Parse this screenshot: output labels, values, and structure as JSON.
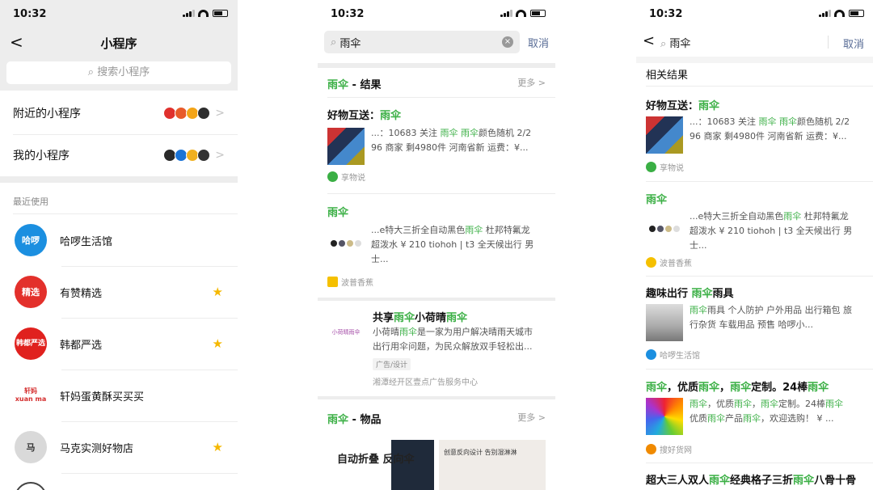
{
  "status": {
    "time": "10:32"
  },
  "p1": {
    "back": "<",
    "title": "小程序",
    "search_placeholder": "搜索小程序",
    "menu": [
      {
        "label": "附近的小程序",
        "icon_colors": [
          "#e0312d",
          "#e85b2a",
          "#2e2e2e",
          "#f3a417"
        ]
      },
      {
        "label": "我的小程序",
        "icon_colors": [
          "#2a2a2a",
          "#1a73d6",
          "#f0b020",
          "#333333"
        ]
      }
    ],
    "recent_label": "最近使用",
    "apps": [
      {
        "name": "哈啰生活馆",
        "avatar_text": "哈啰",
        "color": "#1b8fe0",
        "star": false
      },
      {
        "name": "有赞精选",
        "avatar_text": "精选",
        "color": "#e3302b",
        "star": true
      },
      {
        "name": "韩都严选",
        "avatar_text": "韩都严选",
        "color": "#e0211e",
        "star": true
      },
      {
        "name": "轩妈蛋黄酥买买买",
        "avatar_text": "轩妈 xuan ma",
        "color": "#d42d2d",
        "star": false
      },
      {
        "name": "马克实测好物店",
        "avatar_text": "马",
        "color": "#cfcfcf",
        "star": true
      }
    ],
    "star": "★",
    "chevron": ">"
  },
  "p2": {
    "query": "雨伞",
    "clear": "×",
    "cancel": "取消",
    "results_head": {
      "kw": "雨伞",
      "rest": " - 结果",
      "more": "更多 >"
    },
    "r1": {
      "title_a": "好物互送：",
      "title_kw": "雨伞",
      "desc_a": "...：10683 关注 ",
      "desc_kw1": "雨伞",
      "desc_sp": " ",
      "desc_kw2": "雨伞",
      "desc_b": "颜色随机 2/2",
      "desc_l2": "96 商家 剩4980件 河南省新 运费：¥...",
      "src": "享物说"
    },
    "r2": {
      "title": "雨伞",
      "desc_a": "...e特大三折全自动黑色",
      "desc_kw": "雨伞",
      "desc_b": " 杜邦特氟龙",
      "desc_l2": "超泼水 ¥ 210 tiohoh | t3 全天候出行 男",
      "desc_l3": "士...",
      "src": "波普香蕉"
    },
    "ad": {
      "logo_text": "小荷晴雨伞",
      "title_a": "共享",
      "title_kw1": "雨伞",
      "title_b": "小荷晴",
      "title_kw2": "雨伞",
      "l1_a": "小荷晴",
      "l1_kw": "雨伞",
      "l1_b": "是一家为用户解决晴雨天城市",
      "l2": "出行用伞问题，为民众解放双手轻松出...",
      "tag": "广告/设计",
      "src": "湘潭经开区壹点广告服务中心"
    },
    "goods_head": {
      "kw": "雨伞",
      "rest": " - 物品",
      "more": "更多 >"
    },
    "goods": [
      {
        "text": "自动折叠 反向伞"
      },
      {
        "text": "创意反向设计 告别湿淋淋"
      }
    ]
  },
  "p3": {
    "back": "<",
    "query": "雨伞",
    "cancel": "取消",
    "related": "相关结果",
    "r1": {
      "title_a": "好物互送：",
      "title_kw": "雨伞",
      "desc_a": "...：10683 关注 ",
      "desc_kw1": "雨伞",
      "desc_sp": " ",
      "desc_kw2": "雨伞",
      "desc_b": "颜色随机 2/2",
      "desc_l2": "96 商家 剩4980件 河南省新 运费：¥...",
      "src": "享物说"
    },
    "r2": {
      "title": "雨伞",
      "desc_a": "...e特大三折全自动黑色",
      "desc_kw": "雨伞",
      "desc_b": " 杜邦特氟龙",
      "desc_l2": "超泼水 ¥ 210 tiohoh | t3 全天候出行 男",
      "desc_l3": "士...",
      "src": "波普香蕉"
    },
    "r3": {
      "title_a": "趣味出行 ",
      "title_kw": "雨伞",
      "title_b": "雨具",
      "desc_kw": "雨伞",
      "desc_a": "雨具 个人防护 户外用品 出行箱包 旅",
      "desc_l2": "行杂货 车载用品 预售 哈啰小...",
      "src": "哈啰生活馆"
    },
    "r4": {
      "t_kw1": "雨伞",
      "t_a": "，优质",
      "t_kw2": "雨伞",
      "t_b": "，",
      "t_kw3": "雨伞",
      "t_c": "定制。24棒",
      "t_kw4": "雨伞",
      "l1_kw1": "雨伞",
      "l1_a": "，优质",
      "l1_kw2": "雨伞",
      "l1_b": "，",
      "l1_kw3": "雨伞",
      "l1_c": "定制。24棒",
      "l1_kw4": "雨伞",
      "l2_a": "优质",
      "l2_kw1": "雨伞",
      "l2_b": "产品",
      "l2_kw2": "雨伞",
      "l2_c": "，欢迎选购！ ¥ ...",
      "src": "搜好货网"
    },
    "r5": {
      "a": "超大三人双人",
      "kw1": "雨伞",
      "b": "经典格子三折",
      "kw2": "雨伞",
      "c": "八骨十骨"
    }
  },
  "colors": {
    "accent": "#3aaf44",
    "link": "#576b95",
    "star": "#f5b800"
  }
}
